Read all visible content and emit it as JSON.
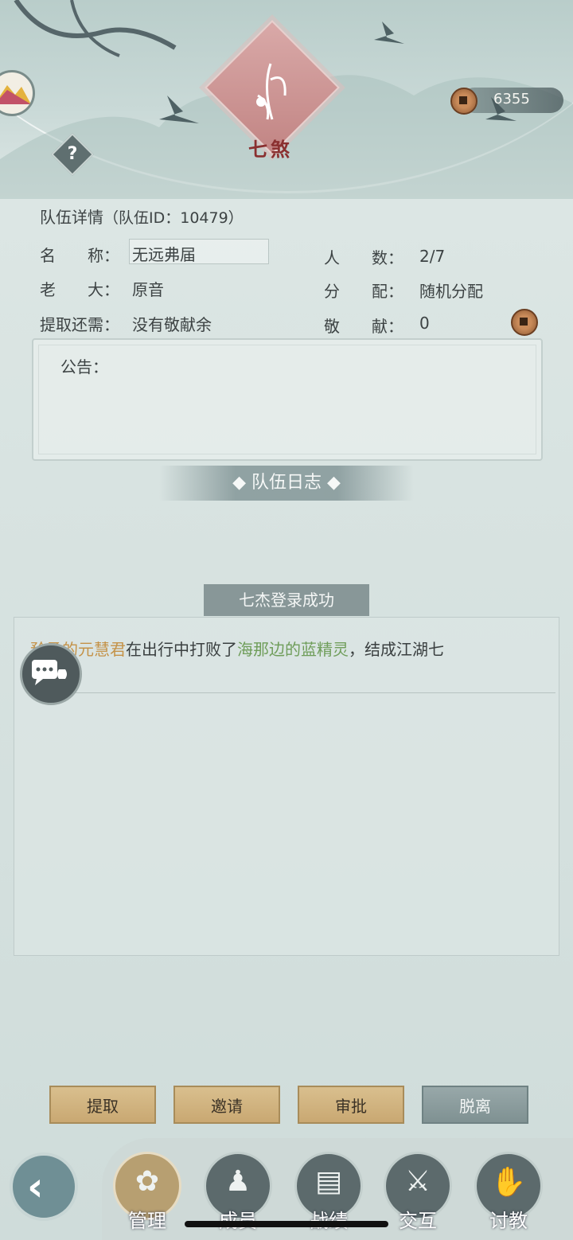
{
  "header": {
    "emblem_text": "七煞",
    "coins": "6355",
    "help_label": "?"
  },
  "team": {
    "title": "队伍详情",
    "team_id": "（队伍ID：10479）",
    "name_label": "名　　称：",
    "name_value": "无远弗届",
    "members_label": "人　　数：",
    "members_value": "2/7",
    "leader_label": "老　　大：",
    "leader_value": "原音",
    "distribution_label": "分　　配：",
    "distribution_value": "随机分配",
    "withdraw_label": "提取还需：",
    "withdraw_value": "没有敬献余",
    "contribution_label": "敬　　献：",
    "contribution_value": "0",
    "notice_label": "公告："
  },
  "log": {
    "banner": "◆ 队伍日志 ◆",
    "entry_title": "七杰登录成功",
    "part1": "矜柔的元慧君",
    "part2": "在出行中打败了",
    "part3": "海那边的蓝精灵",
    "part4": "，结成江湖七"
  },
  "actions": [
    "提取",
    "邀请",
    "审批",
    "脱离"
  ],
  "tabs": [
    {
      "label": "管理",
      "icon": "management-icon",
      "glyph": "✿"
    },
    {
      "label": "成员",
      "icon": "members-icon",
      "glyph": "♟"
    },
    {
      "label": "战绩",
      "icon": "record-icon",
      "glyph": "▤"
    },
    {
      "label": "交互",
      "icon": "interact-icon",
      "glyph": "⚔"
    },
    {
      "label": "讨教",
      "icon": "challenge-icon",
      "glyph": "✋"
    }
  ],
  "colors": {
    "name_orange": "#c49248",
    "name_green": "#6f9d5a",
    "button_gold": "#d2b682",
    "button_gray": "#8c9d9e"
  }
}
